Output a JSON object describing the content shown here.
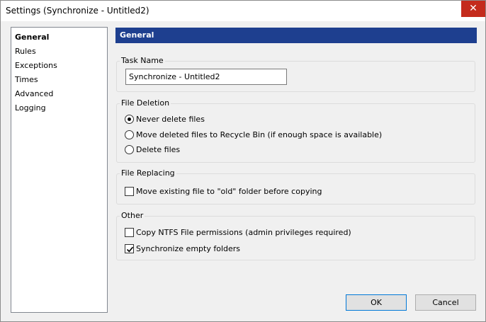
{
  "window": {
    "title": "Settings (Synchronize - Untitled2)",
    "close_glyph": "✕"
  },
  "nav": {
    "items": [
      {
        "label": "General",
        "active": true
      },
      {
        "label": "Rules"
      },
      {
        "label": "Exceptions"
      },
      {
        "label": "Times"
      },
      {
        "label": "Advanced"
      },
      {
        "label": "Logging"
      }
    ]
  },
  "header": {
    "title": "General"
  },
  "task_name": {
    "group_label": "Task Name",
    "value": "Synchronize - Untitled2"
  },
  "file_deletion": {
    "group_label": "File Deletion",
    "options": [
      {
        "label": "Never delete files",
        "checked": true
      },
      {
        "label": "Move deleted files to Recycle Bin (if enough space is available)",
        "checked": false
      },
      {
        "label": "Delete files",
        "checked": false
      }
    ]
  },
  "file_replacing": {
    "group_label": "File Replacing",
    "options": [
      {
        "label": "Move existing file to \"old\" folder before copying",
        "checked": false
      }
    ]
  },
  "other": {
    "group_label": "Other",
    "options": [
      {
        "label": "Copy NTFS File permissions (admin privileges required)",
        "checked": false
      },
      {
        "label": "Synchronize empty folders",
        "checked": true
      }
    ]
  },
  "buttons": {
    "ok": "OK",
    "cancel": "Cancel"
  }
}
